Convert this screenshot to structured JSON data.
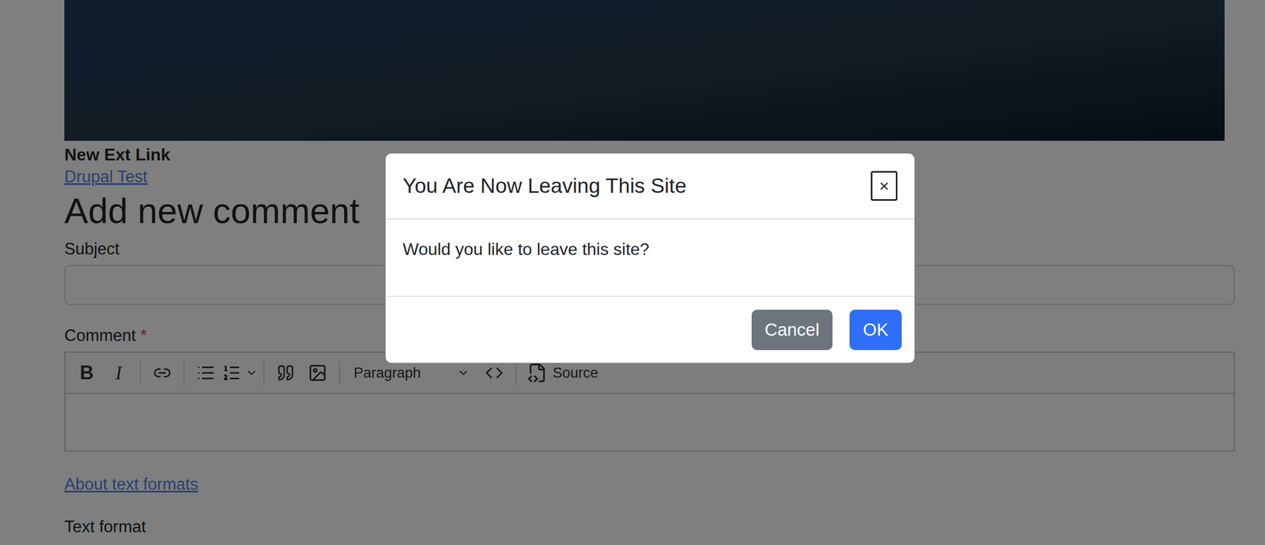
{
  "node": {
    "title": "New Ext Link",
    "link": "Drupal Test"
  },
  "comment_form": {
    "heading": "Add new comment",
    "subject_label": "Subject",
    "subject_value": "",
    "comment_label": "Comment",
    "required_mark": "*",
    "toolbar": {
      "bold": "B",
      "italic": "I",
      "format_select": "Paragraph",
      "source_button": "Source"
    },
    "about_link": "About text formats",
    "text_format_label": "Text format"
  },
  "dialog": {
    "title": "You Are Now Leaving This Site",
    "close": "×",
    "message": "Would you like to leave this site?",
    "buttons": [
      {
        "label": "Cancel",
        "primary": false
      },
      {
        "label": "OK",
        "primary": true
      }
    ]
  }
}
